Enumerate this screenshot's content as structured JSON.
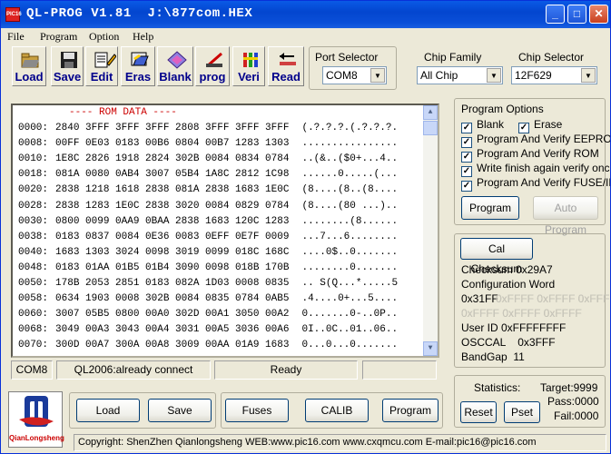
{
  "window": {
    "title": "QL-PROG V1.81  J:\\877com.HEX",
    "icon_text": "PIC16"
  },
  "menu": [
    "File",
    "Program",
    "Option",
    "Help"
  ],
  "toolbar": [
    {
      "label": "Load",
      "icon": "folder-icon"
    },
    {
      "label": "Save",
      "icon": "floppy-icon"
    },
    {
      "label": "Edit",
      "icon": "edit-icon"
    },
    {
      "label": "Eras",
      "icon": "erase-icon"
    },
    {
      "label": "Blank",
      "icon": "blank-icon"
    },
    {
      "label": "prog",
      "icon": "program-icon"
    },
    {
      "label": "Veri",
      "icon": "verify-icon"
    },
    {
      "label": "Read",
      "icon": "read-icon"
    }
  ],
  "port_selector": {
    "label": "Port Selector",
    "value": "COM8"
  },
  "chip_family": {
    "label": "Chip Family",
    "value": "All Chip"
  },
  "chip_selector": {
    "label": "Chip Selector",
    "value": "12F629"
  },
  "rom": {
    "header": "---- ROM DATA ----",
    "rows": [
      {
        "addr": "0000:",
        "hex": "2840 3FFF 3FFF 3FFF 2808 3FFF 3FFF 3FFF",
        "ascii": "(.?.?.?.(.?.?.?."
      },
      {
        "addr": "0008:",
        "hex": "00FF 0E03 0183 00B6 0804 00B7 1283 1303",
        "ascii": "................"
      },
      {
        "addr": "0010:",
        "hex": "1E8C 2826 1918 2824 302B 0084 0834 0784",
        "ascii": "..(&..($0+...4.."
      },
      {
        "addr": "0018:",
        "hex": "081A 0080 0AB4 3007 05B4 1A8C 2812 1C98",
        "ascii": "......0.....(..."
      },
      {
        "addr": "0020:",
        "hex": "2838 1218 1618 2838 081A 2838 1683 1E0C",
        "ascii": "(8....(8..(8...."
      },
      {
        "addr": "0028:",
        "hex": "2838 1283 1E0C 2838 3020 0084 0829 0784",
        "ascii": "(8....(80 ...).."
      },
      {
        "addr": "0030:",
        "hex": "0800 0099 0AA9 0BAA 2838 1683 120C 1283",
        "ascii": "........(8......"
      },
      {
        "addr": "0038:",
        "hex": "0183 0837 0084 0E36 0083 0EFF 0E7F 0009",
        "ascii": "...7...6........"
      },
      {
        "addr": "0040:",
        "hex": "1683 1303 3024 0098 3019 0099 018C 168C",
        "ascii": "....0$..0......."
      },
      {
        "addr": "0048:",
        "hex": "0183 01AA 01B5 01B4 3090 0098 018B 170B",
        "ascii": "........0......."
      },
      {
        "addr": "0050:",
        "hex": "178B 2053 2851 0183 082A 1D03 0008 0835",
        "ascii": ".. S(Q...*.....5"
      },
      {
        "addr": "0058:",
        "hex": "0634 1903 0008 302B 0084 0835 0784 0AB5",
        "ascii": ".4....0+...5...."
      },
      {
        "addr": "0060:",
        "hex": "3007 05B5 0800 00A0 302D 00A1 3050 00A2",
        "ascii": "0.......0-..0P.."
      },
      {
        "addr": "0068:",
        "hex": "3049 00A3 3043 00A4 3031 00A5 3036 00A6",
        "ascii": "0I..0C..01..06.."
      },
      {
        "addr": "0070:",
        "hex": "300D 00A7 300A 00A8 3009 00AA 01A9 1683",
        "ascii": "0...0...0......."
      },
      {
        "addr": "0078:",
        "hex": "160C 1283 0008 3FFF 3FFF 3FFF 3FFF 3FFF",
        "ascii": "......?.?.?.?.?."
      },
      {
        "addr": "0080:",
        "hex": "3FFF 3FFF 3FFF 3FFF 3FFF 3FFF 3FFF 3FFF",
        "ascii": "?.?.?.?.?.?.?.?."
      },
      {
        "addr": "0088:",
        "hex": "3FFF 3FFF 3FFF 3FFF 3FFF 3FFF 3FFF 3FFF",
        "ascii": "?.?.?.?.?.?.?.?."
      }
    ]
  },
  "status": {
    "port": "COM8",
    "connection": "QL2006:already connect",
    "state": "Ready",
    "extra": ""
  },
  "program_options": {
    "title": "Program Options",
    "blank": "Blank",
    "erase": "Erase",
    "items": [
      "Program And Verify EEPROM",
      "Program And Verify ROM",
      "Write finish again verify once",
      "Program And Verify FUSE/ID"
    ],
    "program_button": "Program",
    "auto_program_button": "Auto Program"
  },
  "checksum": {
    "button": "Cal Checksum",
    "checksum": "Checksum 0x29A7",
    "config_label": "Configuration Word",
    "config_line1_first": "0x31FF",
    "config_line1_rest": "0xFFFF 0xFFFF 0xFFFF",
    "config_line2": "0xFFFF 0xFFFF 0xFFFF",
    "user_id": "User ID  0xFFFFFFFF",
    "osccal": "OSCCAL    0x3FFF",
    "bandgap": "BandGap  11"
  },
  "statistics": {
    "label": "Statistics:",
    "target": "Target:9999",
    "pass": "Pass:0000",
    "fail": "Fail:0000",
    "reset": "Reset",
    "pset": "Pset"
  },
  "bottom_buttons": {
    "load": "Load",
    "save": "Save",
    "fuses": "Fuses",
    "calib": "CALIB",
    "program": "Program"
  },
  "logo_text": "QianLongsheng",
  "footer": "Copyright: ShenZhen Qianlongsheng  WEB:www.pic16.com www.cxqmcu.com E-mail:pic16@pic16.com",
  "colors": {
    "title_bar": "#0a4fd8",
    "rom_header": "#cc0000",
    "toolbar_label": "#00008b"
  }
}
